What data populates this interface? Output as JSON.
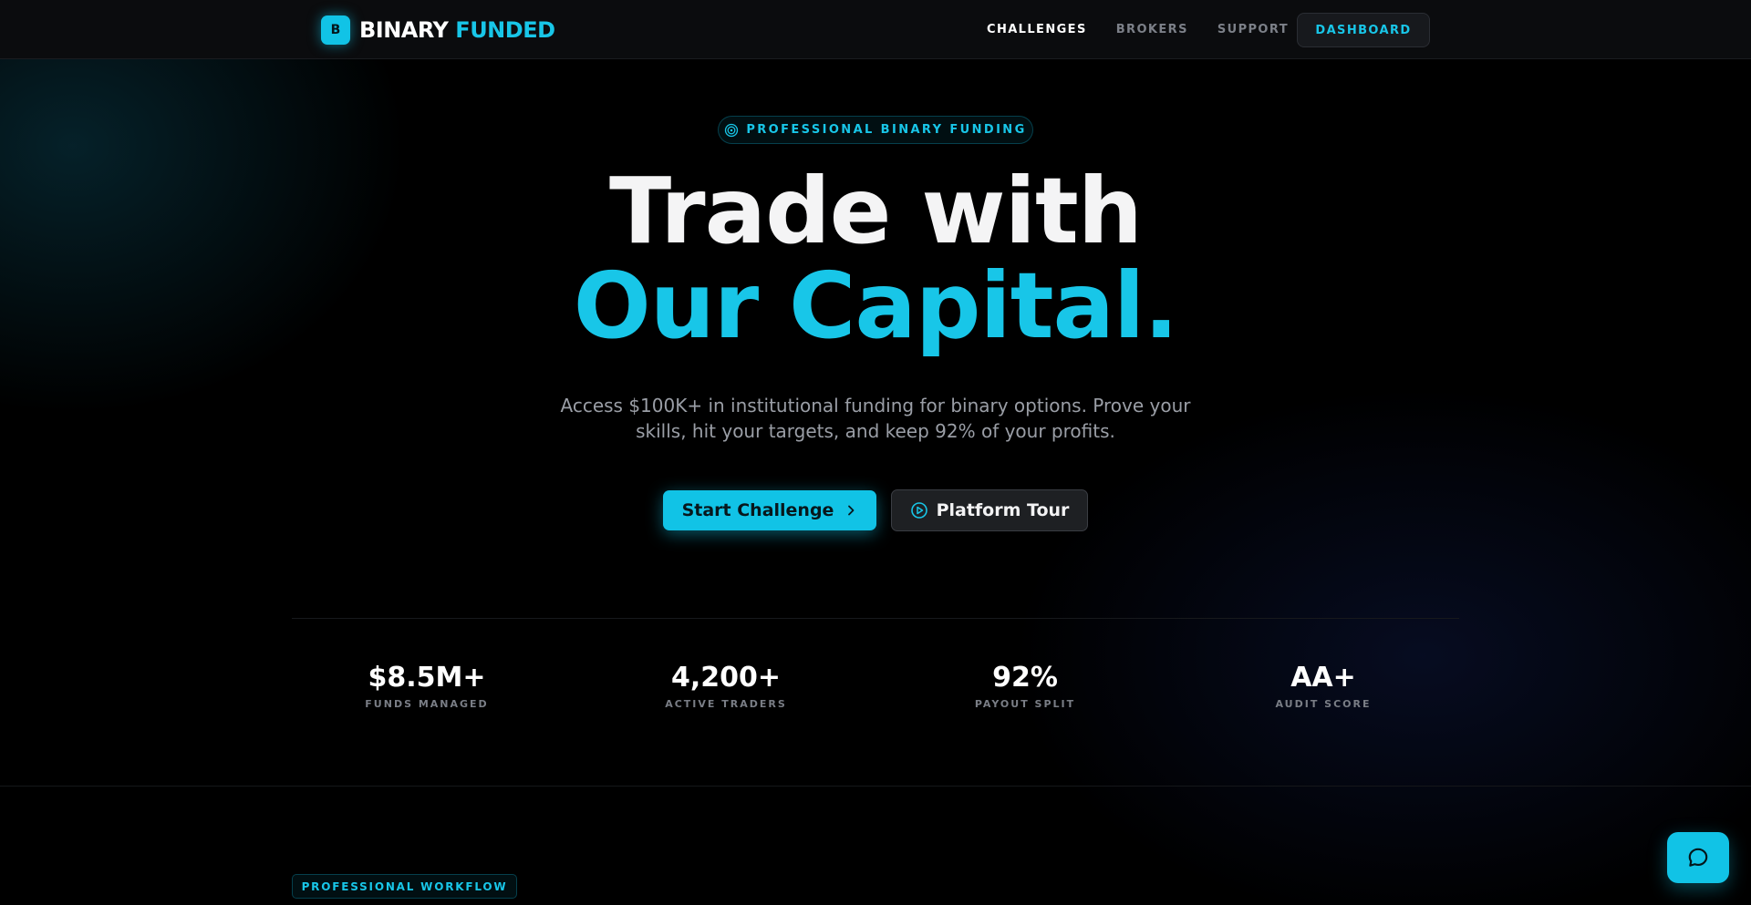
{
  "header": {
    "brand_mark": "B",
    "brand_name_primary": "BINARY",
    "brand_name_accent": "FUNDED",
    "nav": [
      {
        "label": "CHALLENGES",
        "active": true
      },
      {
        "label": "BROKERS",
        "active": false
      },
      {
        "label": "SUPPORT",
        "active": false
      }
    ],
    "dashboard_label": "DASHBOARD"
  },
  "hero": {
    "badge_icon": "target-icon",
    "badge_label": "PROFESSIONAL BINARY FUNDING",
    "title_line1": "Trade with",
    "title_line2": "Our Capital.",
    "subtitle": "Access $100K+ in institutional funding for binary options. Prove your skills, hit your targets, and keep 92% of your profits.",
    "primary_cta": "Start Challenge",
    "primary_cta_icon": "chevron-right-icon",
    "secondary_cta": "Platform Tour",
    "secondary_cta_icon": "play-circle-icon"
  },
  "stats": [
    {
      "value": "$8.5M+",
      "label": "FUNDS MANAGED"
    },
    {
      "value": "4,200+",
      "label": "ACTIVE TRADERS"
    },
    {
      "value": "92%",
      "label": "PAYOUT SPLIT"
    },
    {
      "value": "AA+",
      "label": "AUDIT SCORE"
    }
  ],
  "workflow": {
    "tag": "PROFESSIONAL WORKFLOW"
  },
  "chat": {
    "icon": "chat-bubble-icon"
  },
  "colors": {
    "accent": "#11c3e6",
    "background": "#000000",
    "header_bg": "#0b0c0e",
    "muted_text": "#9a9ea6"
  }
}
